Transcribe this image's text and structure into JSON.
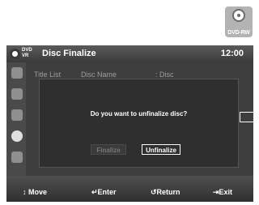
{
  "badge": {
    "label": "DVD-RW",
    "icon": "disc-icon"
  },
  "titlebar": {
    "format": "DVD\nVR",
    "title": "Disc Finalize",
    "clock": "12:00"
  },
  "content": {
    "columns": [
      "Title List",
      "Disc Name",
      ": Disc"
    ]
  },
  "dialog": {
    "message": "Do you want to unfinalize disc?",
    "buttons": {
      "finalize": "Finalize",
      "unfinalize": "Unfinalize"
    }
  },
  "bottom": {
    "move": "↕ Move",
    "enter": "↵Enter",
    "return": "↺Return",
    "exit": "⇥Exit"
  },
  "colors": {
    "panel": "#3e3e3e",
    "titlebar": "#4a4a4a",
    "accent": "#ffffff",
    "disabled": "#777777"
  }
}
